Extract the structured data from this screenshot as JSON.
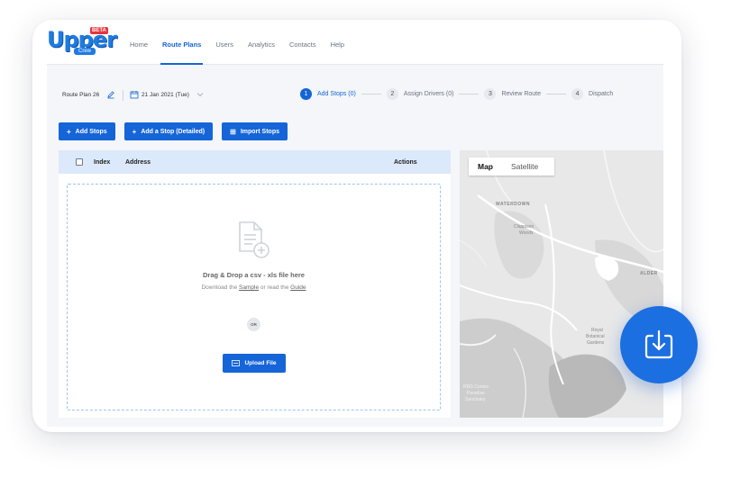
{
  "brand": {
    "name": "Upper",
    "badge": "BETA",
    "sub": "Crew"
  },
  "nav": [
    "Home",
    "Route Plans",
    "Users",
    "Analytics",
    "Contacts",
    "Help"
  ],
  "nav_active": "Route Plans",
  "route": {
    "name": "Route Plan 26",
    "date": "21 Jan 2021 (Tue)"
  },
  "steps": [
    {
      "num": "1",
      "label": "Add Stops (0)",
      "active": true
    },
    {
      "num": "2",
      "label": "Assign Drivers (0)",
      "active": false
    },
    {
      "num": "3",
      "label": "Review Route",
      "active": false
    },
    {
      "num": "4",
      "label": "Dispatch",
      "active": false
    }
  ],
  "buttons": [
    {
      "icon": "+",
      "label": "Add Stops"
    },
    {
      "icon": "+",
      "label": "Add a Stop (Detailed)"
    },
    {
      "icon": "⊞",
      "label": "Import Stops"
    }
  ],
  "table": {
    "index": "Index",
    "address": "Address",
    "actions": "Actions"
  },
  "dropzone": {
    "title": "Drag & Drop a csv - xls file here",
    "sub_pre": "Download the ",
    "sample": "Sample",
    "sub_mid": " or read the ",
    "guide": "Guide",
    "or": "OR",
    "upload": "Upload File"
  },
  "map": {
    "map": "Map",
    "satellite": "Satellite",
    "labels": {
      "waterdown": "WATERDOWN",
      "clappison": "Clappison",
      "woods": "Woods",
      "alder": "ALDER",
      "royal": "Royal",
      "botanical": "Botanical",
      "gardens": "Gardens",
      "rbg": "RBG Cootes",
      "paradise": "Paradise",
      "sanctuary": "Sanctuary"
    }
  },
  "colors": {
    "primary": "#1565d8",
    "header_row": "#dce9fb",
    "fab": "#1b6fe0"
  },
  "icons": {
    "fab": "download-icon"
  }
}
